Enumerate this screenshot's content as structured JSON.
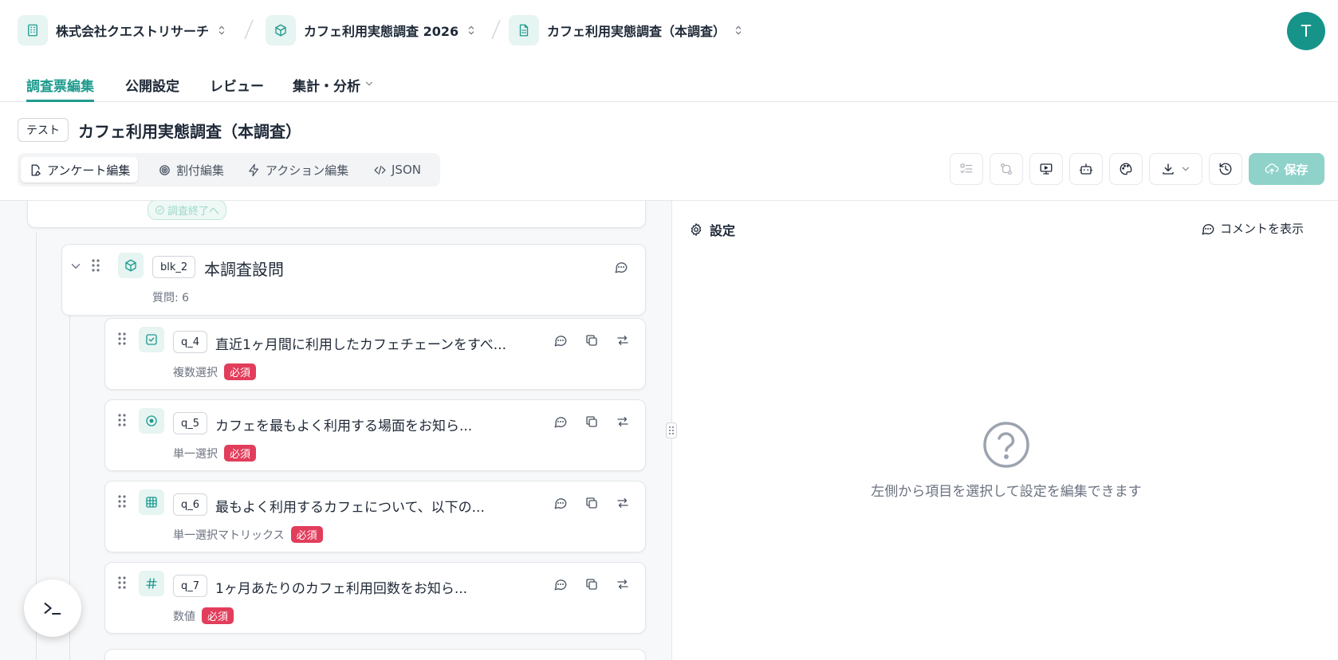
{
  "breadcrumbs": [
    {
      "label": "株式会社クエストリサーチ",
      "icon": "building-icon"
    },
    {
      "label": "カフェ利用実態調査 2026",
      "icon": "box-icon"
    },
    {
      "label": "カフェ利用実態調査（本調査）",
      "icon": "sheet-icon"
    }
  ],
  "avatar": {
    "initial": "T"
  },
  "nav_tabs": [
    {
      "label": "調査票編集",
      "active": true
    },
    {
      "label": "公開設定",
      "active": false
    },
    {
      "label": "レビュー",
      "active": false
    },
    {
      "label": "集計・分析",
      "active": false
    }
  ],
  "survey": {
    "badge": "テスト",
    "title": "カフェ利用実態調査（本調査）"
  },
  "mode_tabs": [
    {
      "label": "アンケート編集",
      "icon": "file-edit-icon",
      "active": true
    },
    {
      "label": "割付編集",
      "icon": "target-icon",
      "active": false
    },
    {
      "label": "アクション編集",
      "icon": "zap-icon",
      "active": false
    },
    {
      "label": "JSON",
      "icon": "code-icon",
      "active": false
    }
  ],
  "toolbar": {
    "save_label": "保存"
  },
  "prev_block": {
    "end_label": "調査終了へ"
  },
  "block": {
    "id": "blk_2",
    "title": "本調査設問",
    "count_label": "質問: 6"
  },
  "questions": [
    {
      "id": "q_4",
      "text": "直近1ヶ月間に利用したカフェチェーンをすべ...",
      "type": "複数選択",
      "required": "必須",
      "icon": "checkbox-icon"
    },
    {
      "id": "q_5",
      "text": "カフェを最もよく利用する場面をお知ら...",
      "type": "単一選択",
      "required": "必須",
      "icon": "radio-icon"
    },
    {
      "id": "q_6",
      "text": "最もよく利用するカフェについて、以下の...",
      "type": "単一選択マトリックス",
      "required": "必須",
      "icon": "grid-icon"
    },
    {
      "id": "q_7",
      "text": "1ヶ月あたりのカフェ利用回数をお知ら...",
      "type": "数値",
      "required": "必須",
      "icon": "hash-icon"
    }
  ],
  "settings": {
    "title": "設定",
    "comment_toggle": "コメントを表示",
    "empty_message": "左側から項目を選択して設定を編集できます"
  },
  "colors": {
    "accent": "#1f9b8e",
    "required": "#e23d5b",
    "save_disabled": "#8fd2ca"
  }
}
